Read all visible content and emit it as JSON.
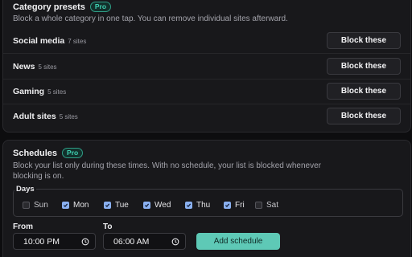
{
  "presets": {
    "title": "Category presets",
    "badge": "Pro",
    "description": "Block a whole category in one tap. You can remove individual sites afterward.",
    "items": [
      {
        "name": "Social media",
        "count": "7 sites",
        "button": "Block these"
      },
      {
        "name": "News",
        "count": "5 sites",
        "button": "Block these"
      },
      {
        "name": "Gaming",
        "count": "5 sites",
        "button": "Block these"
      },
      {
        "name": "Adult sites",
        "count": "5 sites",
        "button": "Block these"
      }
    ]
  },
  "schedules": {
    "title": "Schedules",
    "badge": "Pro",
    "description_line1": "Block your list only during these times. With no schedule, your list is blocked whenever",
    "description_line2": "blocking is on.",
    "days_label": "Days",
    "days": [
      {
        "label": "Sun",
        "checked": false
      },
      {
        "label": "Mon",
        "checked": true
      },
      {
        "label": "Tue",
        "checked": true
      },
      {
        "label": "Wed",
        "checked": true
      },
      {
        "label": "Thu",
        "checked": true
      },
      {
        "label": "Fri",
        "checked": true
      },
      {
        "label": "Sat",
        "checked": false
      }
    ],
    "from_label": "From",
    "from_value": "10:00 PM",
    "to_label": "To",
    "to_value": "06:00 AM",
    "add_button": "Add schedule"
  },
  "colors": {
    "accent": "#5ec9b6",
    "checkbox_checked": "#8ab0f0",
    "pro_badge": "#3fd0b1"
  }
}
